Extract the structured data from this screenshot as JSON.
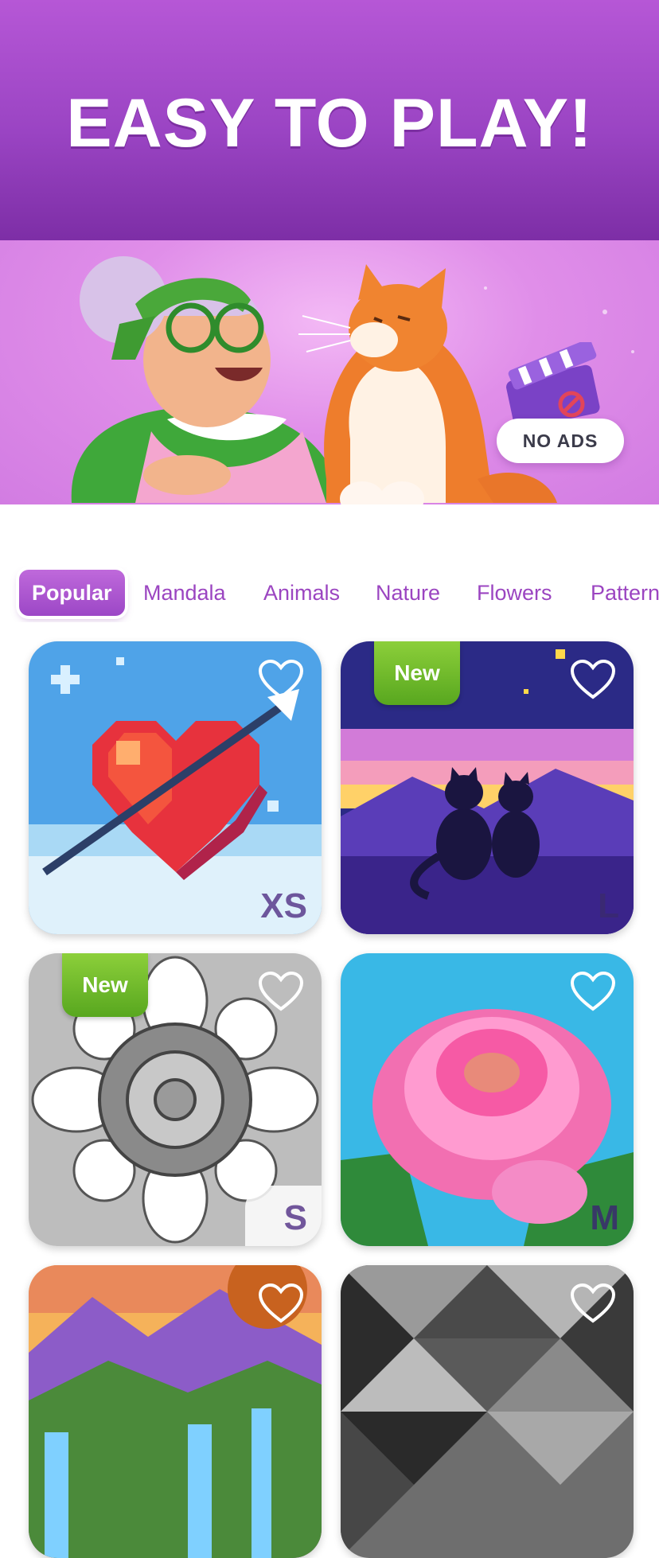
{
  "banner": {
    "headline": "EASY TO PLAY!"
  },
  "hero": {
    "no_ads_label": "NO ADS"
  },
  "tabs": [
    {
      "label": "Popular",
      "active": true
    },
    {
      "label": "Mandala"
    },
    {
      "label": "Animals"
    },
    {
      "label": "Nature"
    },
    {
      "label": "Flowers"
    },
    {
      "label": "Pattern"
    }
  ],
  "cards": [
    {
      "theme": "heart with arrow",
      "size": "XS",
      "badge": ""
    },
    {
      "theme": "two cats at sunset",
      "size": "L",
      "badge": "New"
    },
    {
      "theme": "grey mandala",
      "size": "S",
      "badge": "New"
    },
    {
      "theme": "pink peony",
      "size": "M",
      "badge": ""
    },
    {
      "theme": "waterfall landscape",
      "size": "",
      "badge": ""
    },
    {
      "theme": "grey geometric pattern",
      "size": "",
      "badge": ""
    }
  ],
  "colors": {
    "accent": "#9c47c6",
    "new_badge": "#6bb82a"
  }
}
